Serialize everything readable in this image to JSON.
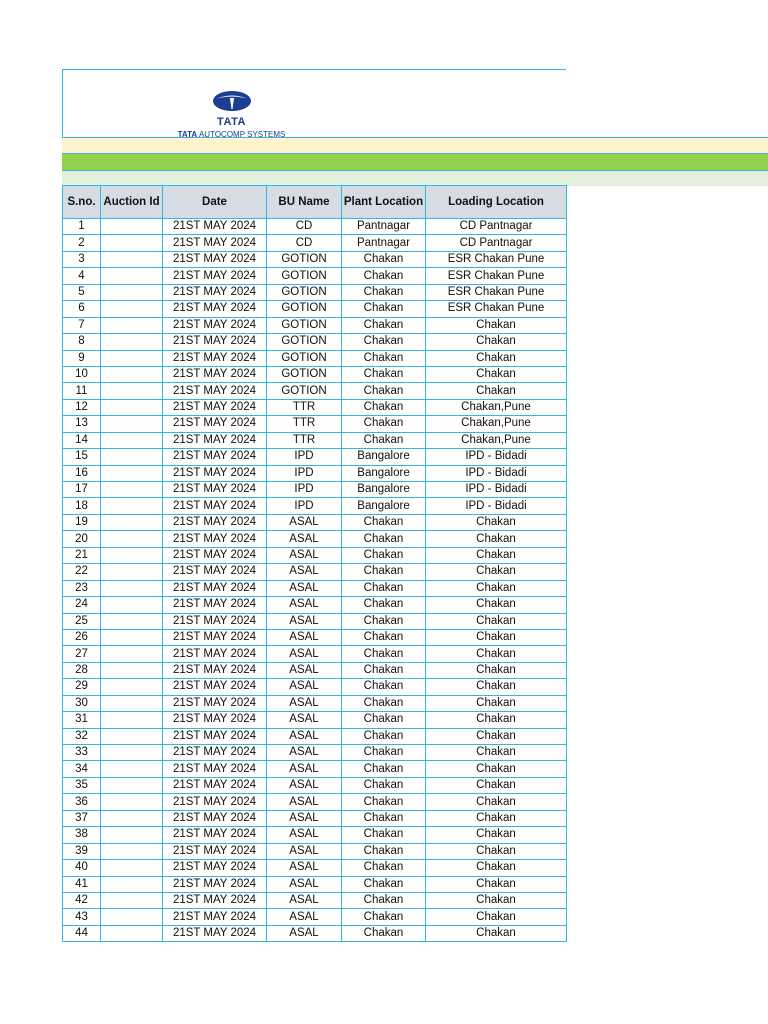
{
  "logo": {
    "brand": "TATA",
    "subtitle_bold": "TATA",
    "subtitle": "AUTOCOMP SYSTEMS"
  },
  "colors": {
    "border": "#33b5e5",
    "header_bg": "#d6dce4",
    "band1": "#fff2cc",
    "band2": "#92d050",
    "band3": "#e2efda",
    "logo": "#1c3f94"
  },
  "table": {
    "headers": [
      "S.no.",
      "Auction Id",
      "Date",
      "BU Name",
      "Plant Location",
      "Loading Location"
    ],
    "rows": [
      [
        "1",
        "",
        "21ST MAY 2024",
        "CD",
        "Pantnagar",
        "CD Pantnagar"
      ],
      [
        "2",
        "",
        "21ST MAY 2024",
        "CD",
        "Pantnagar",
        "CD Pantnagar"
      ],
      [
        "3",
        "",
        "21ST MAY 2024",
        "GOTION",
        "Chakan",
        "ESR Chakan Pune"
      ],
      [
        "4",
        "",
        "21ST MAY 2024",
        "GOTION",
        "Chakan",
        "ESR Chakan Pune"
      ],
      [
        "5",
        "",
        "21ST MAY 2024",
        "GOTION",
        "Chakan",
        "ESR Chakan Pune"
      ],
      [
        "6",
        "",
        "21ST MAY 2024",
        "GOTION",
        "Chakan",
        "ESR Chakan Pune"
      ],
      [
        "7",
        "",
        "21ST MAY 2024",
        "GOTION",
        "Chakan",
        "Chakan"
      ],
      [
        "8",
        "",
        "21ST MAY 2024",
        "GOTION",
        "Chakan",
        "Chakan"
      ],
      [
        "9",
        "",
        "21ST MAY 2024",
        "GOTION",
        "Chakan",
        "Chakan"
      ],
      [
        "10",
        "",
        "21ST MAY 2024",
        "GOTION",
        "Chakan",
        "Chakan"
      ],
      [
        "11",
        "",
        "21ST MAY 2024",
        "GOTION",
        "Chakan",
        "Chakan"
      ],
      [
        "12",
        "",
        "21ST MAY 2024",
        "TTR",
        "Chakan",
        "Chakan,Pune"
      ],
      [
        "13",
        "",
        "21ST MAY 2024",
        "TTR",
        "Chakan",
        "Chakan,Pune"
      ],
      [
        "14",
        "",
        "21ST MAY 2024",
        "TTR",
        "Chakan",
        "Chakan,Pune"
      ],
      [
        "15",
        "",
        "21ST MAY 2024",
        "IPD",
        "Bangalore",
        "IPD - Bidadi"
      ],
      [
        "16",
        "",
        "21ST MAY 2024",
        "IPD",
        "Bangalore",
        "IPD - Bidadi"
      ],
      [
        "17",
        "",
        "21ST MAY 2024",
        "IPD",
        "Bangalore",
        "IPD - Bidadi"
      ],
      [
        "18",
        "",
        "21ST MAY 2024",
        "IPD",
        "Bangalore",
        "IPD - Bidadi"
      ],
      [
        "19",
        "",
        "21ST MAY 2024",
        "ASAL",
        "Chakan",
        "Chakan"
      ],
      [
        "20",
        "",
        "21ST MAY 2024",
        "ASAL",
        "Chakan",
        "Chakan"
      ],
      [
        "21",
        "",
        "21ST MAY 2024",
        "ASAL",
        "Chakan",
        "Chakan"
      ],
      [
        "22",
        "",
        "21ST MAY 2024",
        "ASAL",
        "Chakan",
        "Chakan"
      ],
      [
        "23",
        "",
        "21ST MAY 2024",
        "ASAL",
        "Chakan",
        "Chakan"
      ],
      [
        "24",
        "",
        "21ST MAY 2024",
        "ASAL",
        "Chakan",
        "Chakan"
      ],
      [
        "25",
        "",
        "21ST MAY 2024",
        "ASAL",
        "Chakan",
        "Chakan"
      ],
      [
        "26",
        "",
        "21ST MAY 2024",
        "ASAL",
        "Chakan",
        "Chakan"
      ],
      [
        "27",
        "",
        "21ST MAY 2024",
        "ASAL",
        "Chakan",
        "Chakan"
      ],
      [
        "28",
        "",
        "21ST MAY 2024",
        "ASAL",
        "Chakan",
        "Chakan"
      ],
      [
        "29",
        "",
        "21ST MAY 2024",
        "ASAL",
        "Chakan",
        "Chakan"
      ],
      [
        "30",
        "",
        "21ST MAY 2024",
        "ASAL",
        "Chakan",
        "Chakan"
      ],
      [
        "31",
        "",
        "21ST MAY 2024",
        "ASAL",
        "Chakan",
        "Chakan"
      ],
      [
        "32",
        "",
        "21ST MAY 2024",
        "ASAL",
        "Chakan",
        "Chakan"
      ],
      [
        "33",
        "",
        "21ST MAY 2024",
        "ASAL",
        "Chakan",
        "Chakan"
      ],
      [
        "34",
        "",
        "21ST MAY 2024",
        "ASAL",
        "Chakan",
        "Chakan"
      ],
      [
        "35",
        "",
        "21ST MAY 2024",
        "ASAL",
        "Chakan",
        "Chakan"
      ],
      [
        "36",
        "",
        "21ST MAY 2024",
        "ASAL",
        "Chakan",
        "Chakan"
      ],
      [
        "37",
        "",
        "21ST MAY 2024",
        "ASAL",
        "Chakan",
        "Chakan"
      ],
      [
        "38",
        "",
        "21ST MAY 2024",
        "ASAL",
        "Chakan",
        "Chakan"
      ],
      [
        "39",
        "",
        "21ST MAY 2024",
        "ASAL",
        "Chakan",
        "Chakan"
      ],
      [
        "40",
        "",
        "21ST MAY 2024",
        "ASAL",
        "Chakan",
        "Chakan"
      ],
      [
        "41",
        "",
        "21ST MAY 2024",
        "ASAL",
        "Chakan",
        "Chakan"
      ],
      [
        "42",
        "",
        "21ST MAY 2024",
        "ASAL",
        "Chakan",
        "Chakan"
      ],
      [
        "43",
        "",
        "21ST MAY 2024",
        "ASAL",
        "Chakan",
        "Chakan"
      ],
      [
        "44",
        "",
        "21ST MAY 2024",
        "ASAL",
        "Chakan",
        "Chakan"
      ]
    ]
  }
}
